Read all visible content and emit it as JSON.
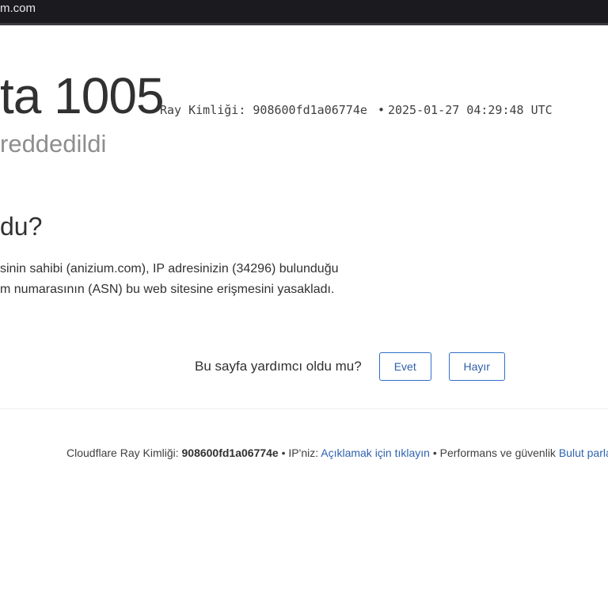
{
  "browser": {
    "url_fragment": "m.com"
  },
  "error": {
    "code_text": "ta 1005",
    "subtitle": "reddedildi",
    "ray_label": "Ray Kimliği:",
    "ray_id": "908600fd1a06774e",
    "separator": "•",
    "timestamp": "2025-01-27 04:29:48 UTC"
  },
  "section": {
    "heading": "du?",
    "lines": [
      "sinin sahibi (anizium.com), IP adresinizin (34296) bulunduğu",
      "m numarasının (ASN) bu web sitesine erişmesini yasakladı."
    ]
  },
  "feedback": {
    "question": "Bu sayfa yardımcı oldu mu?",
    "yes_label": "Evet",
    "no_label": "Hayır"
  },
  "footer": {
    "ray_prefix": "Cloudflare Ray Kimliği:",
    "ray_id": "908600fd1a06774e",
    "bullet": "•",
    "ip_prefix": "IP'niz:",
    "ip_link": "Açıklamak için tıklayın",
    "perf_text": "Performans ve güvenlik",
    "perf_link": "Bulut parla"
  }
}
